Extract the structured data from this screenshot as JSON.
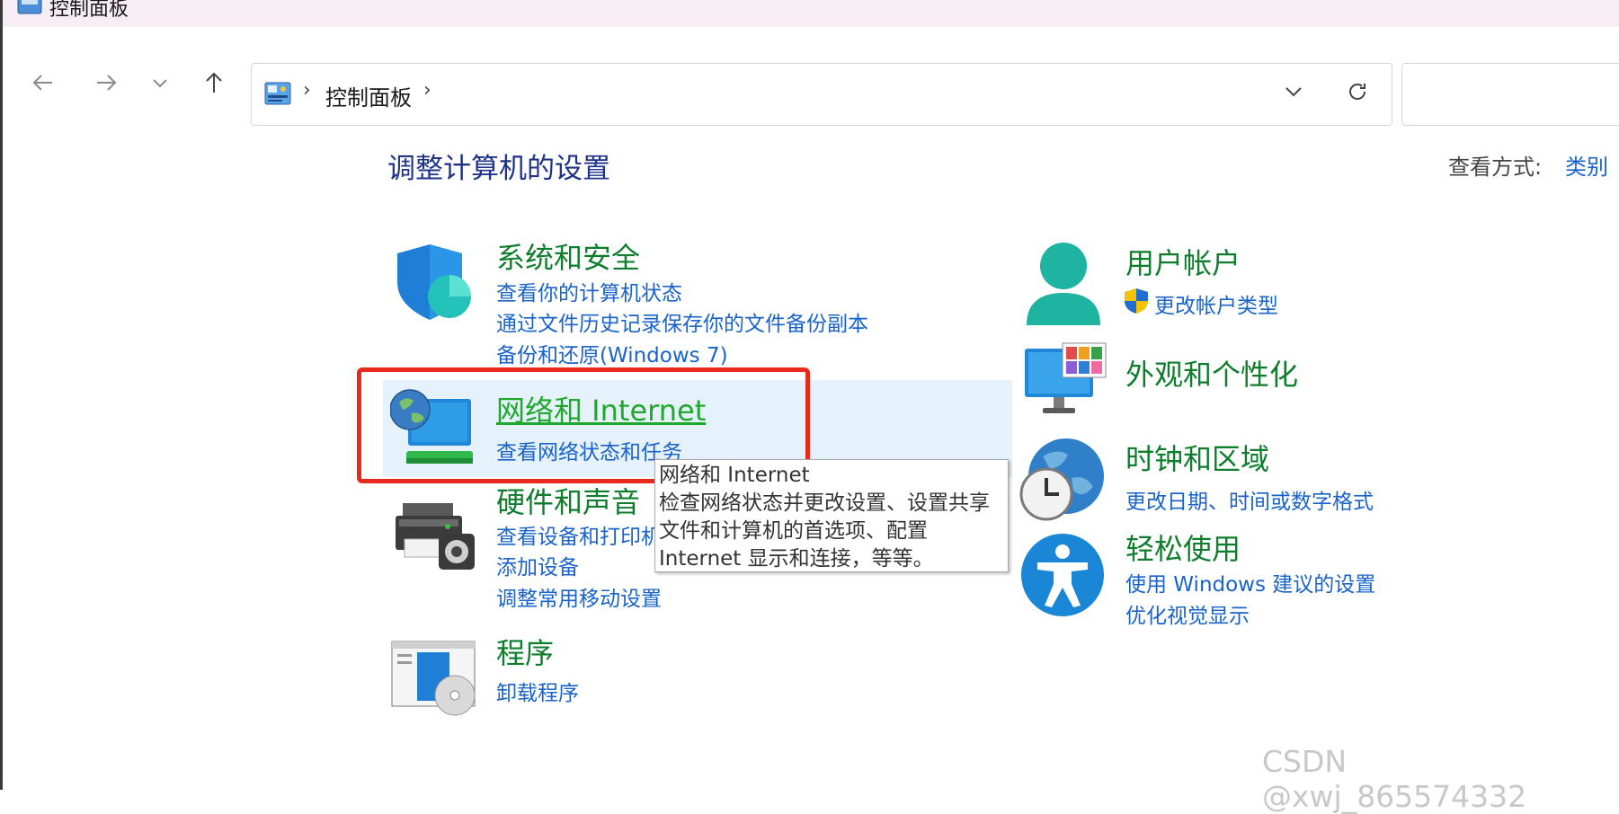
{
  "window": {
    "title": "控制面板"
  },
  "nav": {
    "back_icon": "arrow-left-icon",
    "forward_icon": "arrow-right-icon",
    "recent_icon": "chevron-down-icon",
    "up_icon": "arrow-up-icon"
  },
  "address": {
    "crumbs": [
      "控制面板"
    ],
    "separator": "›",
    "dropdown_icon": "chevron-down-icon",
    "refresh_icon": "refresh-icon"
  },
  "search": {
    "placeholder": ""
  },
  "main": {
    "heading": "调整计算机的设置",
    "view_by_label": "查看方式:",
    "view_by_value": "类别",
    "left_categories": [
      {
        "title": "系统和安全",
        "icon": "shield-icon",
        "links": [
          "查看你的计算机状态",
          "通过文件历史记录保存你的文件备份副本",
          "备份和还原(Windows 7)"
        ]
      },
      {
        "title": "网络和 Internet",
        "icon": "network-globe-icon",
        "links": [
          "查看网络状态和任务"
        ]
      },
      {
        "title": "硬件和声音",
        "icon": "printer-icon",
        "links": [
          "查看设备和打印机",
          "添加设备",
          "调整常用移动设置"
        ]
      },
      {
        "title": "程序",
        "icon": "programs-icon",
        "links": [
          "卸载程序"
        ]
      }
    ],
    "right_categories": [
      {
        "title": "用户帐户",
        "icon": "user-icon",
        "links": [
          "更改帐户类型"
        ]
      },
      {
        "title": "外观和个性化",
        "icon": "monitor-icon",
        "links": []
      },
      {
        "title": "时钟和区域",
        "icon": "clock-globe-icon",
        "links": [
          "更改日期、时间或数字格式"
        ]
      },
      {
        "title": "轻松使用",
        "icon": "accessibility-icon",
        "links": [
          "使用 Windows 建议的设置",
          "优化视觉显示"
        ]
      }
    ]
  },
  "tooltip": {
    "lines": [
      "网络和 Internet",
      "检查网络状态并更改设置、设置共享",
      "文件和计算机的首选项、配置",
      "Internet 显示和连接，等等。"
    ]
  },
  "watermark": "CSDN @xwj_865574332",
  "colors": {
    "category_title": "#0e7d2c",
    "link": "#1a63c9",
    "heading": "#1e3287",
    "highlight_bg": "#e5f1fb",
    "annotation_red": "#e8291e"
  }
}
